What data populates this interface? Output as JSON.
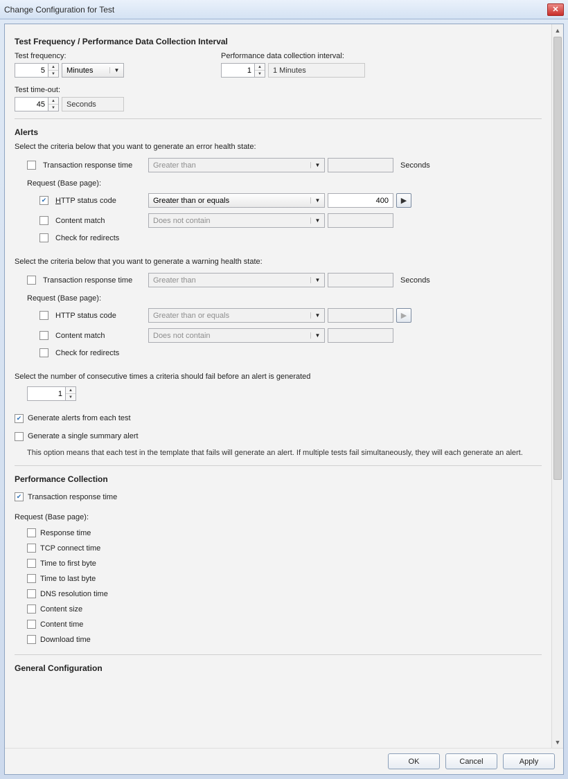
{
  "window": {
    "title": "Change Configuration for Test"
  },
  "freq": {
    "heading": "Test Frequency / Performance Data Collection Interval",
    "test_freq_label": "Test frequency:",
    "test_freq_value": "5",
    "test_freq_unit": "Minutes",
    "perf_interval_label": "Performance data collection interval:",
    "perf_interval_value": "1",
    "perf_interval_text": "1 Minutes",
    "timeout_label": "Test time-out:",
    "timeout_value": "45",
    "timeout_unit": "Seconds"
  },
  "alerts": {
    "heading": "Alerts",
    "error_intro": "Select the criteria below that you want to generate an error health state:",
    "warning_intro": "Select the criteria below that you want to generate a warning health state:",
    "trt_label": "Transaction response time",
    "trt_op": "Greater than",
    "seconds": "Seconds",
    "request_heading": "Request (Base page):",
    "http_label": "HTTP status code",
    "http_op": "Greater than or equals",
    "http_value": "400",
    "content_label": "Content match",
    "content_op": "Does not contain",
    "redirect_label": "Check for redirects",
    "consecutive_label": "Select the number of consecutive times a criteria should fail before an alert is generated",
    "consecutive_value": "1",
    "gen_each_label": "Generate alerts from each test",
    "gen_single_label": "Generate a single summary alert",
    "desc": "This option means that each test in the template that fails will generate an alert. If multiple tests fail simultaneously, they will each generate an alert."
  },
  "perf": {
    "heading": "Performance Collection",
    "trt_label": "Transaction response time",
    "request_heading": "Request (Base page):",
    "items": {
      "response": "Response time",
      "tcp": "TCP connect time",
      "ttfb": "Time to first byte",
      "ttlb": "Time to last byte",
      "dns": "DNS resolution time",
      "csize": "Content size",
      "ctime": "Content time",
      "dl": "Download time"
    }
  },
  "general": {
    "heading": "General Configuration"
  },
  "buttons": {
    "ok": "OK",
    "cancel": "Cancel",
    "apply": "Apply"
  }
}
